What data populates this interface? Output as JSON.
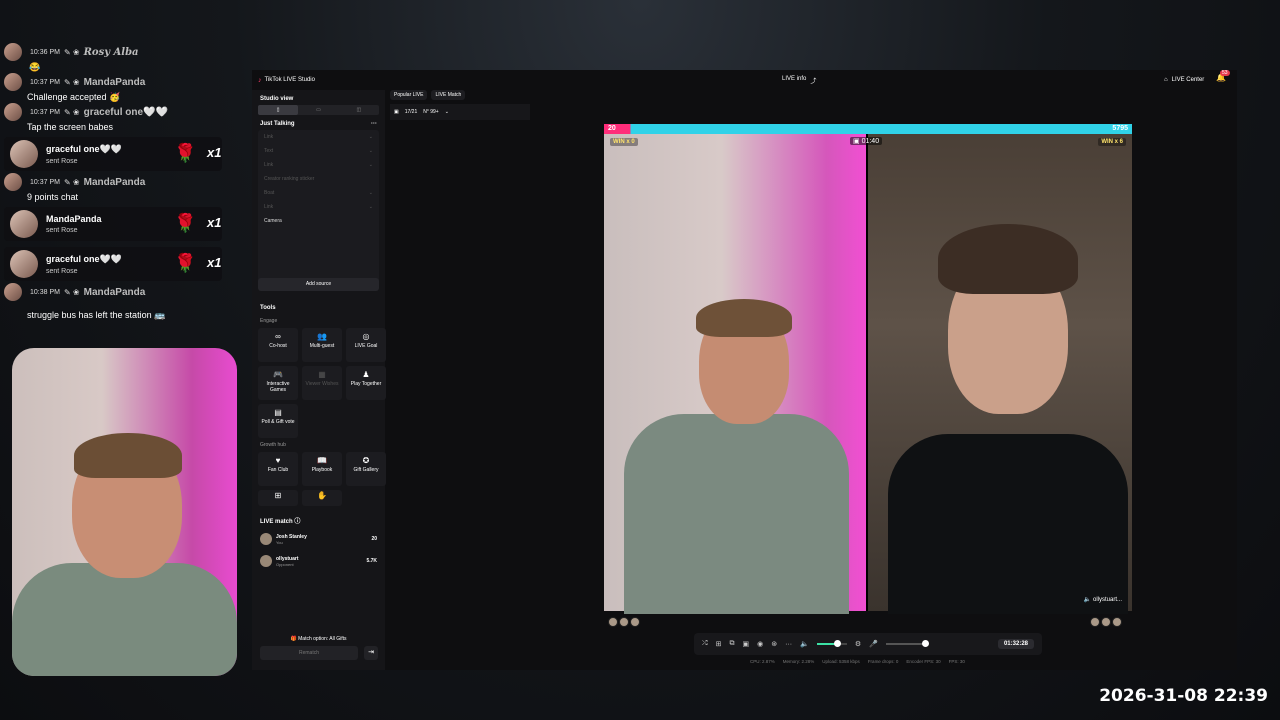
{
  "chat": {
    "messages": [
      {
        "time": "10:36 PM",
        "user": "Rosy Alba",
        "text": "😂"
      },
      {
        "time": "10:37 PM",
        "user": "MandaPanda",
        "text": "Challenge accepted 🥳"
      },
      {
        "time": "10:37 PM",
        "user": "graceful one🤍🤍",
        "text": "Tap the screen babes"
      },
      {
        "time": "10:37 PM",
        "user": "MandaPanda",
        "text": "9 points chat"
      },
      {
        "time": "10:38 PM",
        "user": "MandaPanda",
        "text": "struggle bus has left the station 🚌"
      }
    ],
    "gifts": [
      {
        "user": "graceful one🤍🤍",
        "sub": "sent Rose",
        "count": "x1"
      },
      {
        "user": "MandaPanda",
        "sub": "sent Rose",
        "count": "x1"
      },
      {
        "user": "graceful one🤍🤍",
        "sub": "sent Rose",
        "count": "x1"
      }
    ]
  },
  "studio": {
    "app_title": "TikTok LIVE Studio",
    "live_info": "LIVE info",
    "live_center": "LIVE Center",
    "notif_count": "53",
    "studio_view": "Studio view",
    "scene": "Just Talking",
    "sources": [
      "Link",
      "Text",
      "Link",
      "Creator ranking sticker",
      "Boat",
      "Link",
      "Camera"
    ],
    "add_source": "Add source",
    "tools_title": "Tools",
    "engage_label": "Engage",
    "engage_tools": [
      "Co-host",
      "Multi-guest",
      "LIVE Goal",
      "Interactive Games",
      "Viewer Wishes",
      "Play Together",
      "Poll & Gift vote"
    ],
    "growth_label": "Growth hub",
    "growth_tools": [
      "Fan Club",
      "Playbook",
      "Gift Gallery"
    ],
    "live_match_title": "LIVE match",
    "players": [
      {
        "name": "Josh Stanley",
        "role": "You",
        "score": "20"
      },
      {
        "name": "ollystuart",
        "role": "Opponent",
        "score": "5.7K"
      }
    ],
    "match_option": "Match option: All Gifts",
    "rematch": "Rematch",
    "tabs": [
      "Popular LIVE",
      "LIVE Match"
    ],
    "mini_progress": "17/21",
    "mini_rank": "N° 99+"
  },
  "battle": {
    "left_score": "20",
    "right_score": "5795",
    "left_win": "WIN x 0",
    "right_win": "WIN x 6",
    "timer": "01:40",
    "opponent_tag": "ollystuart..."
  },
  "controls": {
    "stream_time": "01:32:28",
    "stats": [
      "CPU: 2.87%",
      "Memory: 2.28%",
      "Upload: 5358 kbps",
      "Frame drops: 0",
      "Encoder FPS: 30",
      "FPS: 30"
    ]
  },
  "overlay_timestamp": "2026-31-08 22:39"
}
